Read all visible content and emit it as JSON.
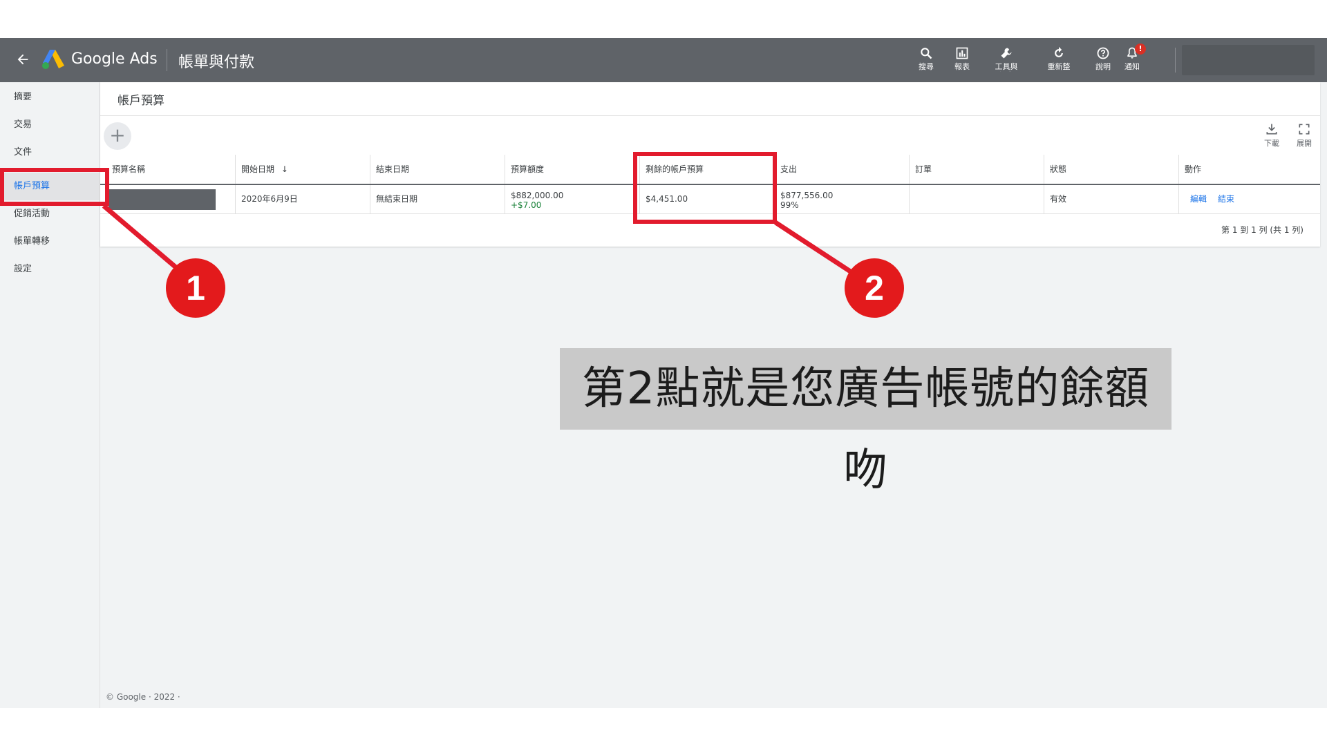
{
  "topbar": {
    "brand": "Google Ads",
    "title": "帳單與付款",
    "tools": [
      {
        "icon": "search-icon",
        "label": "搜尋"
      },
      {
        "icon": "reports-icon",
        "label": "報表"
      },
      {
        "icon": "wrench-icon",
        "label": "工具與設定"
      },
      {
        "icon": "refresh-icon",
        "label": "重新整理"
      },
      {
        "icon": "help-icon",
        "label": "說明"
      },
      {
        "icon": "bell-icon",
        "label": "通知"
      }
    ],
    "notification_badge": "!"
  },
  "sidebar": {
    "items": [
      {
        "label": "摘要"
      },
      {
        "label": "交易"
      },
      {
        "label": "文件"
      },
      {
        "label": "帳戶預算",
        "active": true
      },
      {
        "label": "促銷活動"
      },
      {
        "label": "帳單轉移"
      },
      {
        "label": "設定"
      }
    ]
  },
  "main": {
    "title": "帳戶預算",
    "actions": {
      "download": "下載",
      "expand": "展開"
    },
    "table": {
      "columns": [
        "預算名稱",
        "開始日期",
        "結束日期",
        "預算額度",
        "剩餘的帳戶預算",
        "支出",
        "訂單",
        "狀態",
        "動作"
      ],
      "rows": [
        {
          "start_date": "2020年6月9日",
          "end_date": "無結束日期",
          "budget_amount": "$882,000.00",
          "budget_adjust": "+$7.00",
          "remaining": "$4,451.00",
          "spend": "$877,556.00",
          "spend_pct": "99%",
          "order": "",
          "status": "有效",
          "action_edit": "編輯",
          "action_end": "結束"
        }
      ]
    },
    "pagination": "第 1 到 1 列 (共 1 列)"
  },
  "footer": "© Google · 2022 ·",
  "annotations": {
    "marker_1": "1",
    "marker_2": "2",
    "caption": "第2點就是您廣告帳號的餘額吻",
    "highlight_color": "#e21b2d"
  },
  "colors": {
    "topbar": "#5f6368",
    "accent": "#1a73e8",
    "positive": "#188038"
  }
}
